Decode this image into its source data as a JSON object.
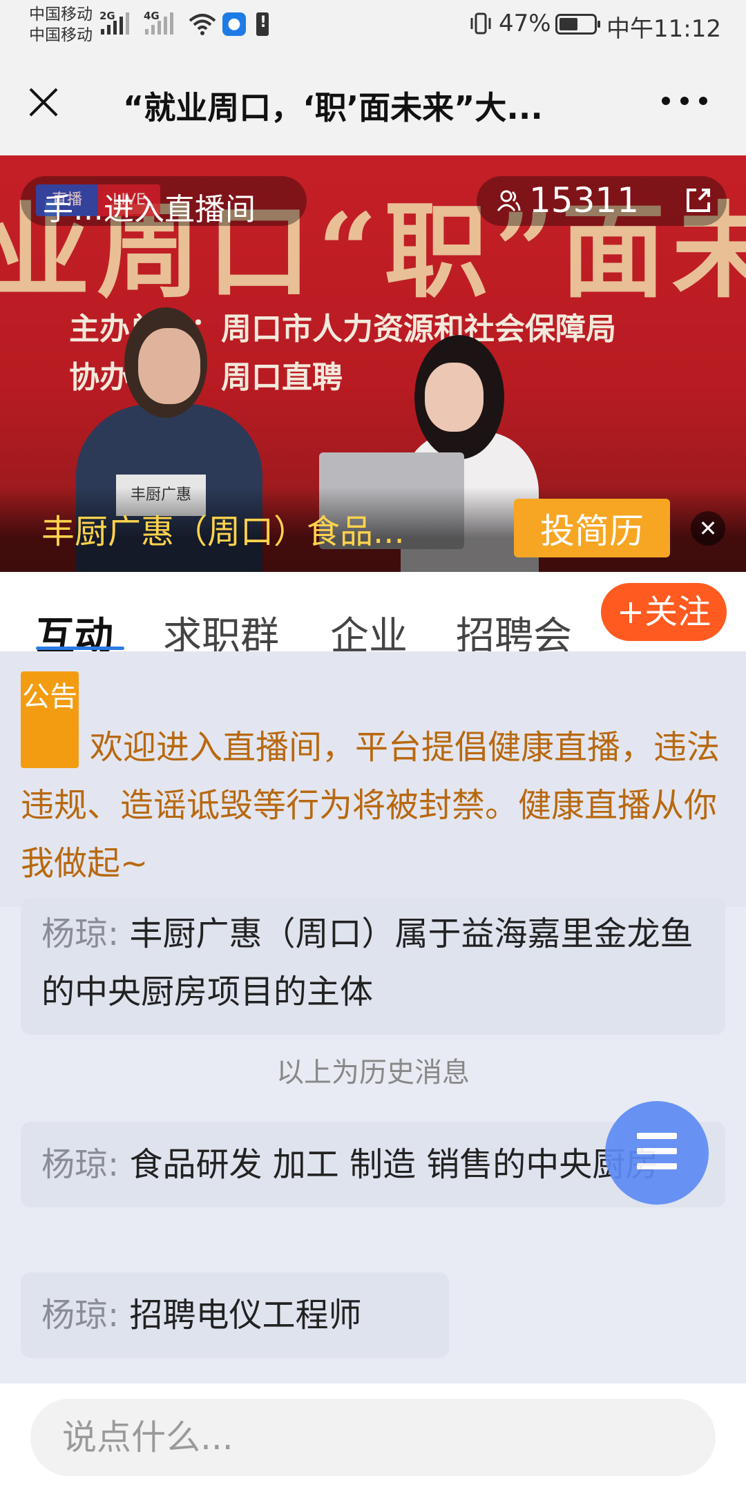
{
  "status_bar": {
    "carrier_1": "中国移动",
    "carrier_2": "中国移动",
    "net_1": "2G",
    "net_2": "4G",
    "battery_percent": "47%",
    "time": "中午11:12"
  },
  "title_bar": {
    "title": "“就业周口，‘职’面未来”大..."
  },
  "video": {
    "enter_live": "手…进入直播间",
    "live_tag_left": "直播",
    "live_tag_right": "LIVE",
    "viewers": "15311",
    "banner_big": "业周口“职”面未",
    "banner_line_1": "主办单位：周口市人力资源和社会保障局",
    "banner_line_2": "协办单位：周口直聘",
    "nameplate": "丰厨广惠",
    "company": "丰厨广惠（周口）食品...",
    "resume_button": "投简历",
    "close_glyph": "✕"
  },
  "tabs": [
    {
      "label": "互动",
      "active": true
    },
    {
      "label": "求职群",
      "active": false
    },
    {
      "label": "企业",
      "active": false
    },
    {
      "label": "招聘会",
      "active": false
    }
  ],
  "follow_button": "+关注",
  "notice": {
    "badge": "公告",
    "text": "欢迎进入直播间，平台提倡健康直播，违法违规、造谣诋毁等行为将被封禁。健康直播从你我做起~"
  },
  "messages": [
    {
      "who": "杨琼:",
      "text": "丰厨广惠（周口）属于益海嘉里金龙鱼的中央厨房项目的主体"
    },
    {
      "who": "杨琼:",
      "text": "食品研发 加工 制造 销售的中央厨房"
    },
    {
      "who": "杨琼:",
      "text": "招聘电仪工程师"
    }
  ],
  "history_divider": "以上为历史消息",
  "input": {
    "placeholder": "说点什么..."
  },
  "colors": {
    "accent_blue": "#2a7be4",
    "follow_orange": "#ff5a1f",
    "notice_orange": "#f39c12",
    "company_yellow": "#ffd34d",
    "fab_blue": "#5d8bf4"
  }
}
